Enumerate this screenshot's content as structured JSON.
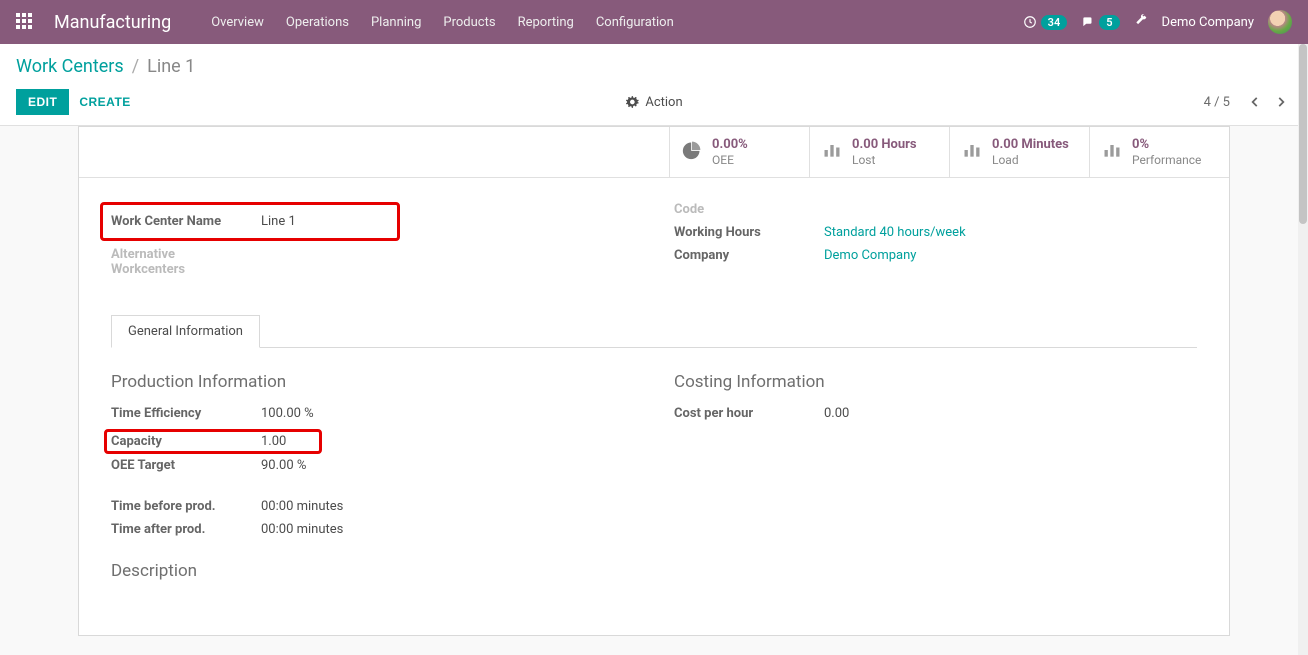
{
  "nav": {
    "brand": "Manufacturing",
    "items": [
      "Overview",
      "Operations",
      "Planning",
      "Products",
      "Reporting",
      "Configuration"
    ],
    "activities_count": "34",
    "messages_count": "5",
    "company": "Demo Company"
  },
  "breadcrumb": {
    "parent": "Work Centers",
    "sep": "/",
    "current": "Line 1"
  },
  "buttons": {
    "edit": "EDIT",
    "create": "CREATE",
    "action": "Action"
  },
  "pager": {
    "position": "4 / 5"
  },
  "kpis": [
    {
      "value": "0.00%",
      "label": "OEE",
      "icon": "pie"
    },
    {
      "value": "0.00 Hours",
      "label": "Lost",
      "icon": "bars"
    },
    {
      "value": "0.00 Minutes",
      "label": "Load",
      "icon": "bars"
    },
    {
      "value": "0%",
      "label": "Performance",
      "icon": "bars"
    }
  ],
  "fields": {
    "left": {
      "name_label": "Work Center Name",
      "name_value": "Line 1",
      "alt_label_1": "Alternative",
      "alt_label_2": "Workcenters"
    },
    "right": {
      "code_label": "Code",
      "code_value": "",
      "hours_label": "Working Hours",
      "hours_value": "Standard 40 hours/week",
      "company_label": "Company",
      "company_value": "Demo Company"
    }
  },
  "tabs": {
    "general": "General Information"
  },
  "sections": {
    "prod_title": "Production Information",
    "cost_title": "Costing Information",
    "desc_title": "Description"
  },
  "prod": {
    "eff_label": "Time Efficiency",
    "eff_value": "100.00  %",
    "cap_label": "Capacity",
    "cap_value": "1.00",
    "oee_label": "OEE Target",
    "oee_value": "90.00  %",
    "before_label": "Time before prod.",
    "before_value": "00:00 minutes",
    "after_label": "Time after prod.",
    "after_value": "00:00 minutes"
  },
  "cost": {
    "cph_label": "Cost per hour",
    "cph_value": "0.00"
  }
}
